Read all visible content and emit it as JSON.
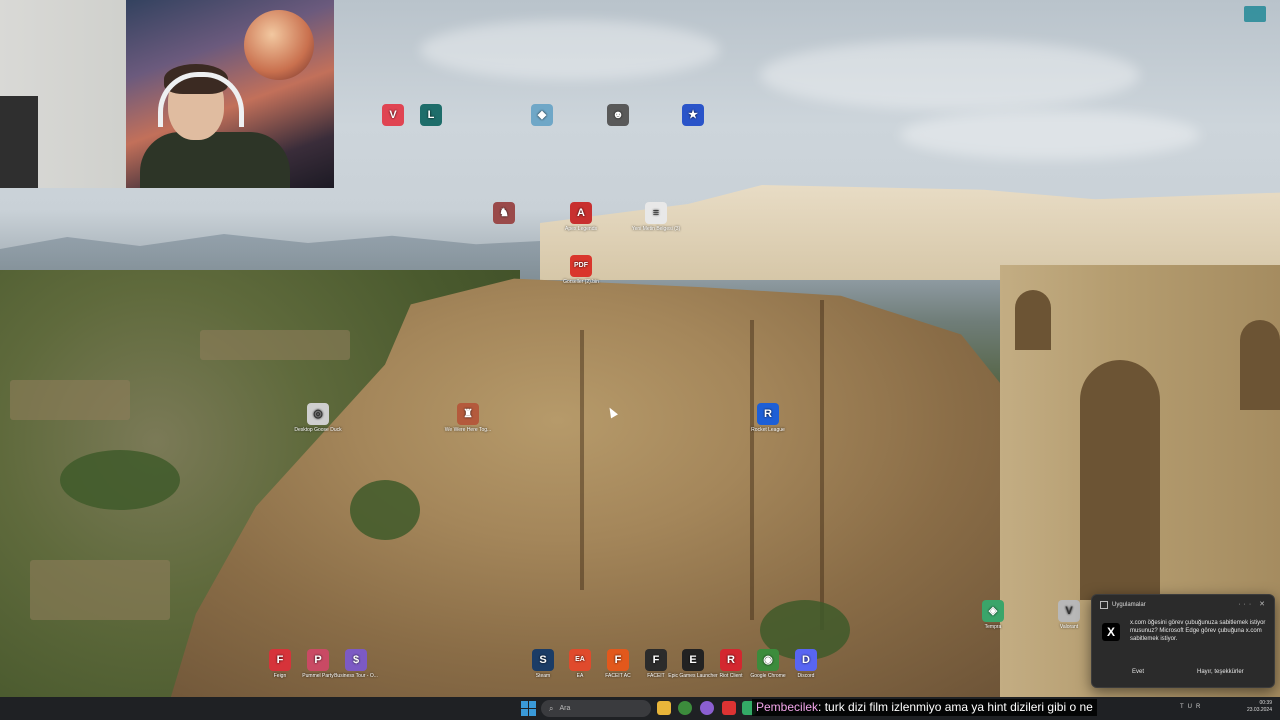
{
  "webcam": {
    "label": ""
  },
  "desktop_icons": [
    {
      "name": "valorant",
      "label": "",
      "glyph": "V",
      "color": "#e04452"
    },
    {
      "name": "league",
      "label": "",
      "glyph": "L",
      "color": "#1e6d6a"
    },
    {
      "name": "app3",
      "label": "",
      "glyph": "◆",
      "color": "#6fa7c7"
    },
    {
      "name": "app4",
      "label": "",
      "glyph": "☻",
      "color": "#595959"
    },
    {
      "name": "app5",
      "label": "",
      "glyph": "★",
      "color": "#2a54c9"
    },
    {
      "name": "app6",
      "label": "",
      "glyph": "♞",
      "color": "#9a4a4a"
    },
    {
      "name": "apex",
      "label": "Apex Legends",
      "glyph": "A",
      "color": "#c8302f"
    },
    {
      "name": "yeni-metin",
      "label": "Yeni Metin Belgesi (3)",
      "glyph": "≡",
      "color": "#e8e8e8"
    },
    {
      "name": "pdf",
      "label": "Gorseller (2).bin",
      "glyph": "PDF",
      "color": "#d9362c"
    },
    {
      "name": "goose",
      "label": "Desktop Goose Duck",
      "glyph": "◎",
      "color": "#cfcfcf"
    },
    {
      "name": "wethere",
      "label": "We Were Here Tog...",
      "glyph": "♜",
      "color": "#b45a3c"
    },
    {
      "name": "rocket",
      "label": "Rocket League",
      "glyph": "R",
      "color": "#1d5fd6"
    },
    {
      "name": "feign",
      "label": "Feign",
      "glyph": "F",
      "color": "#d6333a"
    },
    {
      "name": "pummel",
      "label": "Pummel Party",
      "glyph": "P",
      "color": "#c94a64"
    },
    {
      "name": "business",
      "label": "Business Tour - O...",
      "glyph": "$",
      "color": "#7c5ac4"
    },
    {
      "name": "steam",
      "label": "Steam",
      "glyph": "S",
      "color": "#1b3c66"
    },
    {
      "name": "ea",
      "label": "EA",
      "glyph": "EA",
      "color": "#e04a2c"
    },
    {
      "name": "faceit-ac",
      "label": "FACEIT AC",
      "glyph": "F",
      "color": "#e2581c"
    },
    {
      "name": "faceit",
      "label": "FACEIT",
      "glyph": "F",
      "color": "#2b2b2b"
    },
    {
      "name": "epic",
      "label": "Epic Games Launcher",
      "glyph": "E",
      "color": "#222"
    },
    {
      "name": "riot",
      "label": "Riot Client",
      "glyph": "R",
      "color": "#d3272f"
    },
    {
      "name": "chrome",
      "label": "Google Chrome",
      "glyph": "◉",
      "color": "#3c8c3c"
    },
    {
      "name": "discord",
      "label": "Discord",
      "glyph": "D",
      "color": "#5865f2"
    },
    {
      "name": "tempra",
      "label": "Tempra",
      "glyph": "◈",
      "color": "#3aa56a"
    },
    {
      "name": "valorant2",
      "label": "Valorant",
      "glyph": "V",
      "color": "#b8b8b8"
    }
  ],
  "notification": {
    "app": "Uygulamalar",
    "body": "x.com öğesini görev çubuğunuza sabitlemek istiyor musunuz? Microsoft Edge görev çubuğuna x.com sabitlemek istiyor.",
    "accept": "Evet",
    "decline": "Hayır, teşekkürler",
    "logo": "X"
  },
  "taskbar": {
    "search_placeholder": "Ara",
    "language": "TUR",
    "time": "00:39",
    "date": "23.03.2024"
  },
  "chat_overlay": {
    "user": "Pembecilek",
    "message": ": turk dizi film izlenmiyo ama ya hint dizileri gibi o ne"
  }
}
